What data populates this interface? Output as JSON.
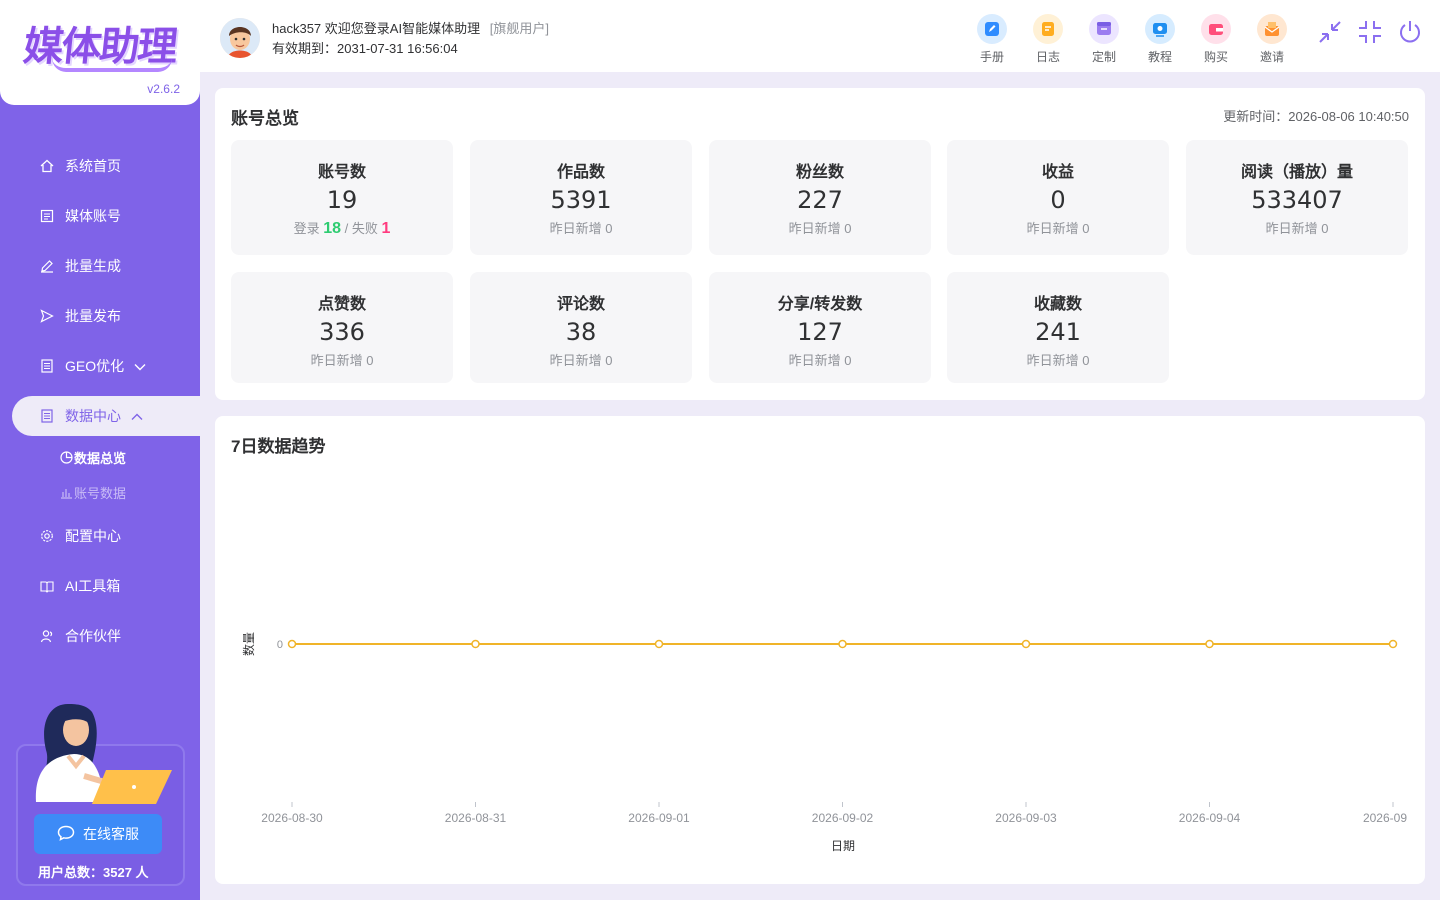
{
  "app": {
    "logo_text": "媒体助理",
    "version": "v2.6.2"
  },
  "sidebar": {
    "items": [
      {
        "label": "系统首页",
        "icon": "home-icon"
      },
      {
        "label": "媒体账号",
        "icon": "account-icon"
      },
      {
        "label": "批量生成",
        "icon": "edit-icon"
      },
      {
        "label": "批量发布",
        "icon": "send-icon"
      },
      {
        "label": "GEO优化",
        "icon": "document-icon"
      },
      {
        "label": "数据中心",
        "icon": "data-icon"
      },
      {
        "label": "配置中心",
        "icon": "gear-icon"
      },
      {
        "label": "AI工具箱",
        "icon": "book-icon"
      },
      {
        "label": "合作伙伴",
        "icon": "partner-icon"
      }
    ],
    "sub_items": [
      {
        "label": "数据总览",
        "icon": "pie-icon"
      },
      {
        "label": "账号数据",
        "icon": "bar-chart-icon"
      }
    ],
    "support_label": "在线客服",
    "user_total": "用户总数：3527 人"
  },
  "header": {
    "username": "hack357",
    "welcome": "欢迎您登录AI智能媒体助理",
    "user_tag": "[旗舰用户]",
    "expire": "有效期到：2031-07-31 16:56:04",
    "tools": [
      {
        "label": "手册",
        "color": "#3d9bff",
        "icon": "manual-icon"
      },
      {
        "label": "日志",
        "color": "#ffb020",
        "icon": "log-icon"
      },
      {
        "label": "定制",
        "color": "#9b7cf0",
        "icon": "custom-icon"
      },
      {
        "label": "教程",
        "color": "#1f8ff0",
        "icon": "tutorial-icon"
      },
      {
        "label": "购买",
        "color": "#ff5a8a",
        "icon": "wallet-icon"
      },
      {
        "label": "邀请",
        "color": "#ff9f43",
        "icon": "invite-icon"
      }
    ]
  },
  "overview": {
    "title": "账号总览",
    "update_time": "更新时间：2026-08-06 10:40:50",
    "stats": [
      {
        "label": "账号数",
        "value": "19",
        "login_label": "登录",
        "login": "18",
        "sep": "/",
        "fail_label": "失败",
        "fail": "1"
      },
      {
        "label": "作品数",
        "value": "5391",
        "sub": "昨日新增 0"
      },
      {
        "label": "粉丝数",
        "value": "227",
        "sub": "昨日新增 0"
      },
      {
        "label": "收益",
        "value": "0",
        "sub": "昨日新增 0"
      },
      {
        "label": "阅读（播放）量",
        "value": "533407",
        "sub": "昨日新增 0"
      },
      {
        "label": "点赞数",
        "value": "336",
        "sub": "昨日新增 0"
      },
      {
        "label": "评论数",
        "value": "38",
        "sub": "昨日新增 0"
      },
      {
        "label": "分享/转发数",
        "value": "127",
        "sub": "昨日新增 0"
      },
      {
        "label": "收藏数",
        "value": "241",
        "sub": "昨日新增 0"
      }
    ]
  },
  "trend": {
    "title": "7日数据趋势"
  },
  "chart_data": {
    "type": "line",
    "x": [
      "2026-08-30",
      "2026-08-31",
      "2026-09-01",
      "2026-09-02",
      "2026-09-03",
      "2026-09-04",
      "2026-09"
    ],
    "series": [
      {
        "values": [
          0,
          0,
          0,
          0,
          0,
          0,
          0
        ],
        "color": "#f0b429"
      }
    ],
    "y_ticks": [
      "0"
    ],
    "xlabel": "日期",
    "ylabel": "数量",
    "grid": false
  }
}
